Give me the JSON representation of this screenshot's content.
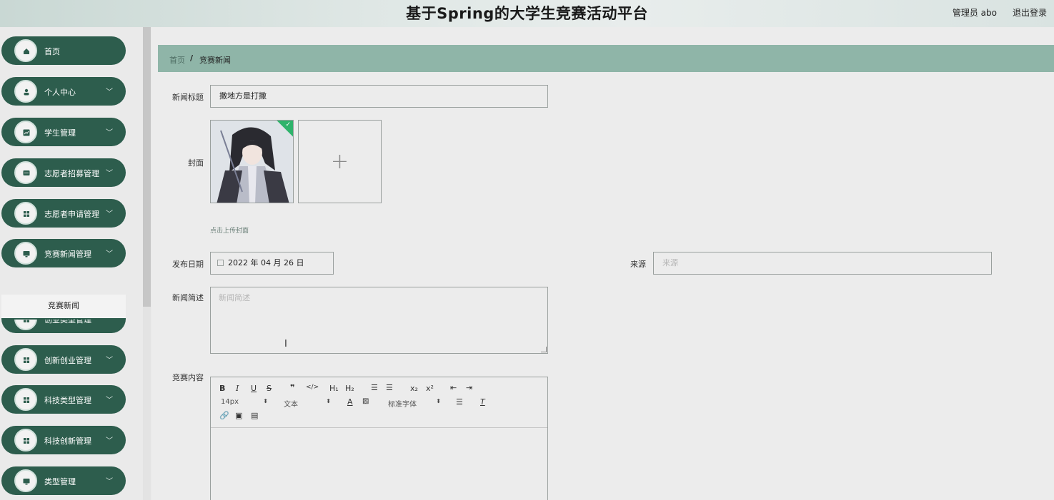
{
  "header": {
    "title": "基于Spring的大学生竞赛活动平台",
    "user": "管理员 abo",
    "logout": "退出登录"
  },
  "sidebar": {
    "items": [
      {
        "label": "首页",
        "icon": "home-icon",
        "chevron": false
      },
      {
        "label": "个人中心",
        "icon": "person-icon",
        "chevron": true
      },
      {
        "label": "学生管理",
        "icon": "chart-icon",
        "chevron": true
      },
      {
        "label": "志愿者招募管理",
        "icon": "chat-icon",
        "chevron": true
      },
      {
        "label": "志愿者申请管理",
        "icon": "grid-icon",
        "chevron": true
      },
      {
        "label": "竞赛新闻管理",
        "icon": "monitor-icon",
        "chevron": true
      },
      {
        "label": "创业类型管理",
        "icon": "grid-icon",
        "chevron": true
      },
      {
        "label": "创新创业管理",
        "icon": "grid-icon",
        "chevron": true
      },
      {
        "label": "科技类型管理",
        "icon": "grid-icon",
        "chevron": true
      },
      {
        "label": "科技创新管理",
        "icon": "grid-icon",
        "chevron": true
      },
      {
        "label": "类型管理",
        "icon": "monitor-icon",
        "chevron": true
      }
    ],
    "submenu_active": "竞赛新闻"
  },
  "breadcrumb": {
    "home": "首页",
    "separator": "/",
    "current": "竞赛新闻"
  },
  "form": {
    "title_label": "新闻标题",
    "title_value": "撒地方是打撒",
    "cover_label": "封面",
    "cover_hint": "点击上传封面",
    "date_label": "发布日期",
    "date_value": "2022 年 04 月 26 日",
    "source_label": "来源",
    "source_placeholder": "来源",
    "summary_label": "新闻简述",
    "summary_placeholder": "新闻简述",
    "content_label": "竞赛内容"
  },
  "editor": {
    "font_size": "14px",
    "block_type": "文本",
    "font_family": "标准字体"
  },
  "colors": {
    "sidebar_item": "#2d5d4d",
    "breadcrumb_bar": "#8fb5a8",
    "success": "#2fb36b"
  }
}
